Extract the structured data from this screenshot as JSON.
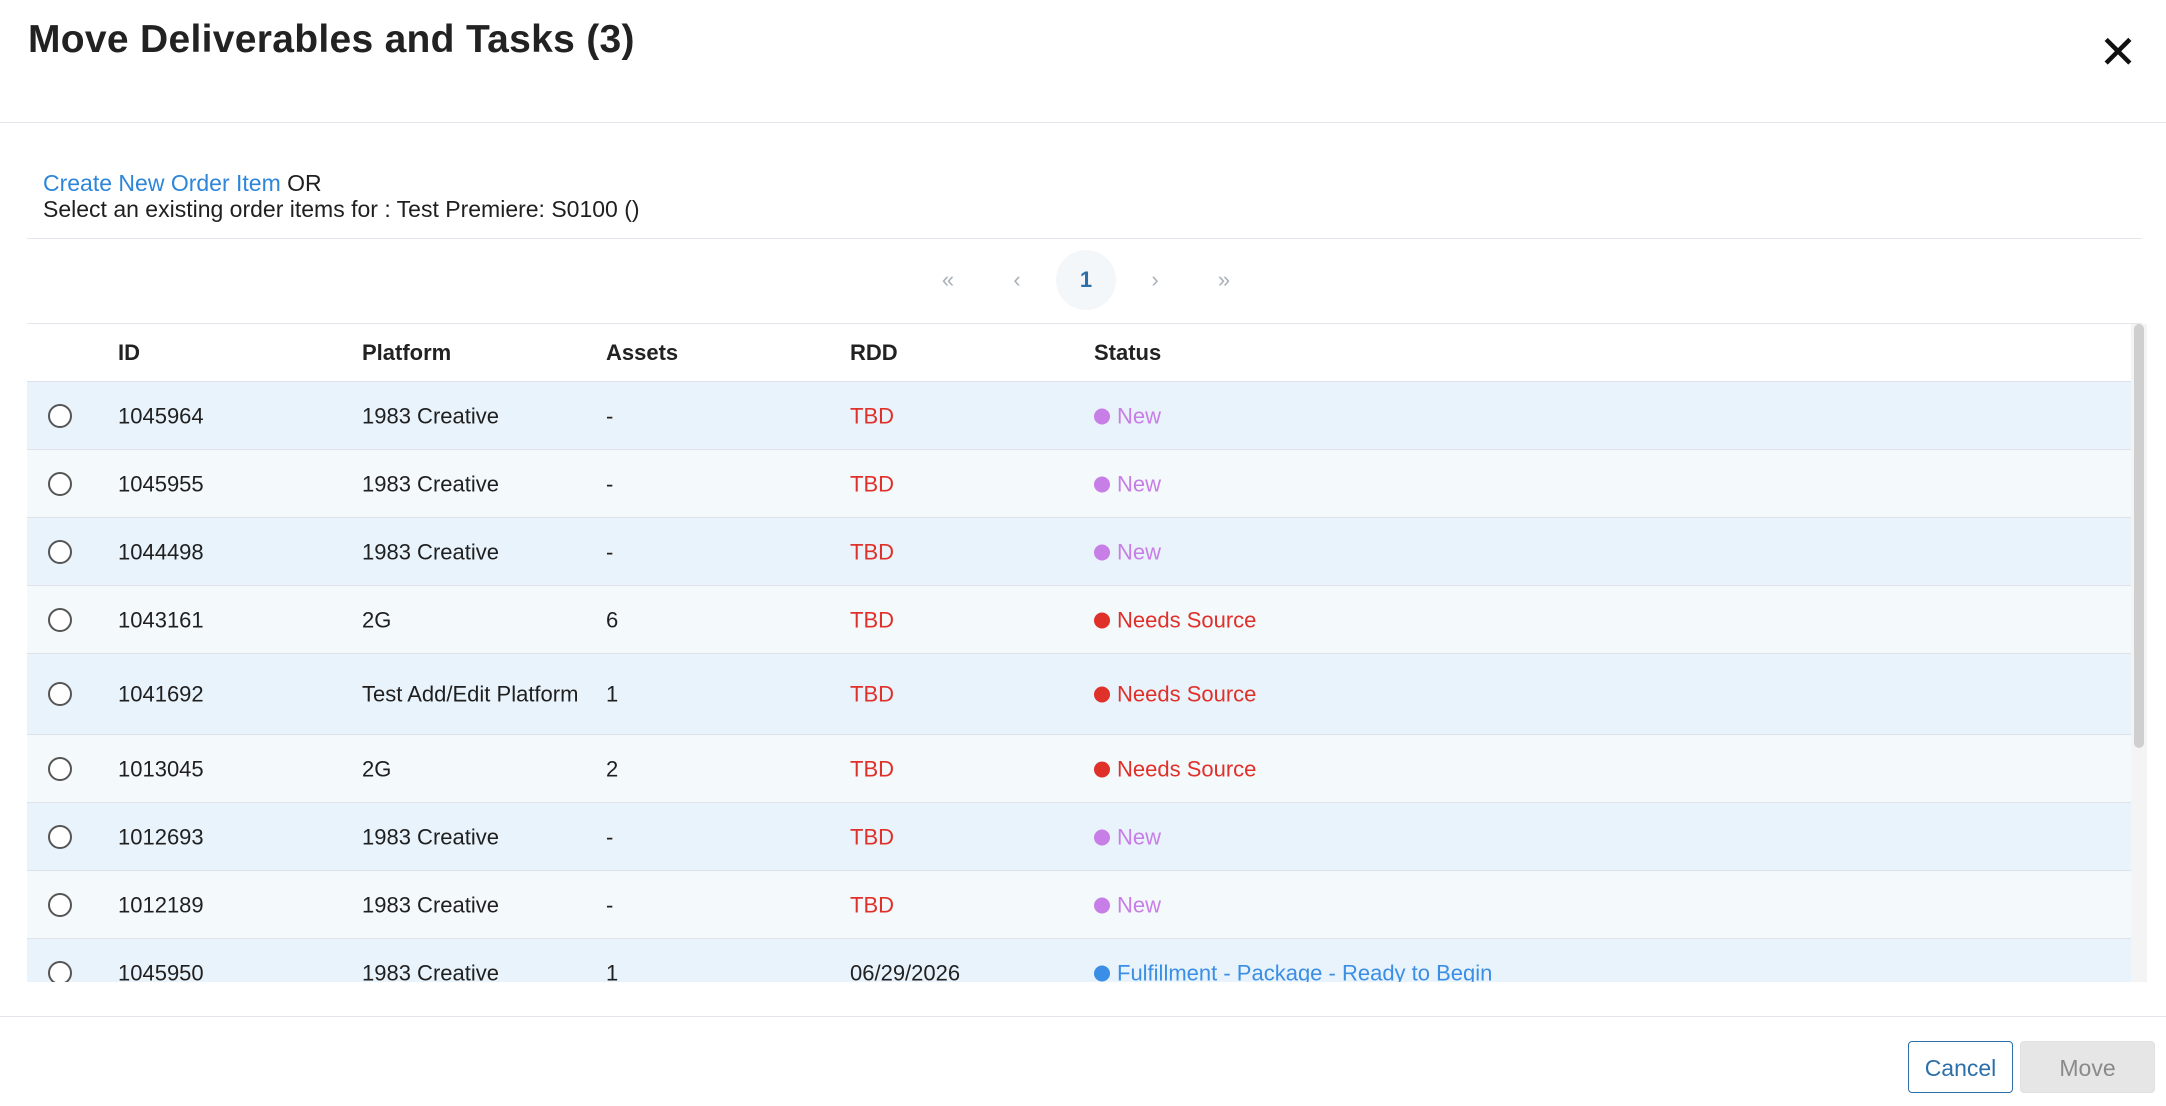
{
  "dialog": {
    "title": "Move Deliverables and Tasks (3)",
    "close_label": "✕"
  },
  "intro": {
    "create_link": "Create New Order Item",
    "or_text": "OR",
    "select_text": "Select an existing order items for : Test Premiere: S0100 ()"
  },
  "pagination": {
    "first": "«",
    "prev": "‹",
    "current": "1",
    "next": "›",
    "last": "»"
  },
  "table": {
    "headers": {
      "id": "ID",
      "platform": "Platform",
      "assets": "Assets",
      "rdd": "RDD",
      "status": "Status"
    },
    "rows": [
      {
        "id": "1045964",
        "platform": "1983 Creative",
        "assets": "-",
        "rdd": "TBD",
        "status": "New"
      },
      {
        "id": "1045955",
        "platform": "1983 Creative",
        "assets": "-",
        "rdd": "TBD",
        "status": "New"
      },
      {
        "id": "1044498",
        "platform": "1983 Creative",
        "assets": "-",
        "rdd": "TBD",
        "status": "New"
      },
      {
        "id": "1043161",
        "platform": "2G",
        "assets": "6",
        "rdd": "TBD",
        "status": "Needs Source"
      },
      {
        "id": "1041692",
        "platform": "Test Add/Edit Platform",
        "assets": "1",
        "rdd": "TBD",
        "status": "Needs Source"
      },
      {
        "id": "1013045",
        "platform": "2G",
        "assets": "2",
        "rdd": "TBD",
        "status": "Needs Source"
      },
      {
        "id": "1012693",
        "platform": "1983 Creative",
        "assets": "-",
        "rdd": "TBD",
        "status": "New"
      },
      {
        "id": "1012189",
        "platform": "1983 Creative",
        "assets": "-",
        "rdd": "TBD",
        "status": "New"
      },
      {
        "id": "1045950",
        "platform": "1983 Creative",
        "assets": "1",
        "rdd": "06/29/2026",
        "status": "Fulfillment - Package - Ready to Begin"
      }
    ]
  },
  "status_colors": {
    "New": "#c77ee6",
    "Needs Source": "#e0302a",
    "Fulfillment - Package - Ready to Begin": "#3a8ee6"
  },
  "rdd_colors": {
    "TBD": "#e0302a",
    "date": "#222222"
  },
  "footer": {
    "cancel_label": "Cancel",
    "move_label": "Move"
  }
}
